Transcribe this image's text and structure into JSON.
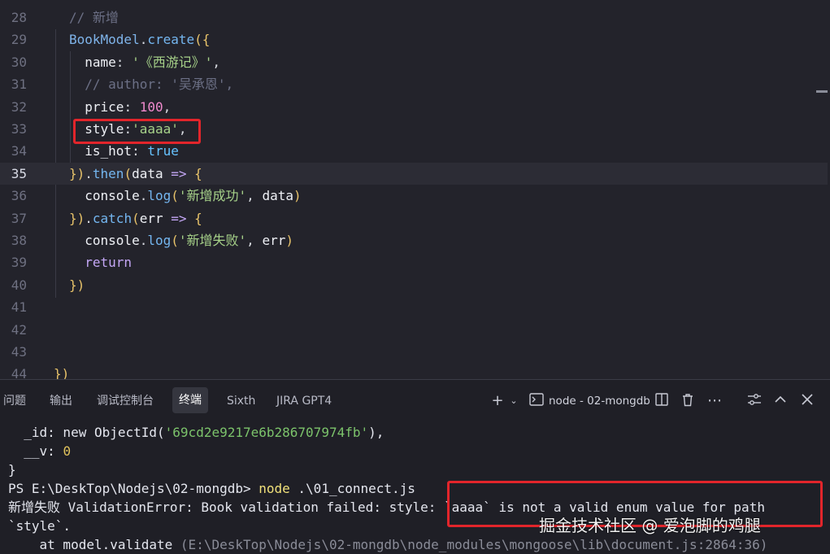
{
  "editor": {
    "lines": [
      {
        "num": "28",
        "segs": [
          {
            "c": "t-com",
            "t": "// 新增"
          }
        ]
      },
      {
        "num": "29",
        "segs": [
          {
            "c": "t-obj",
            "t": "BookModel"
          },
          {
            "c": "t-plain",
            "t": "."
          },
          {
            "c": "t-fn",
            "t": "create"
          },
          {
            "c": "t-pun",
            "t": "({"
          }
        ]
      },
      {
        "num": "30",
        "segs": [
          {
            "c": "t-key",
            "t": "  name"
          },
          {
            "c": "t-plain",
            "t": ": "
          },
          {
            "c": "t-str",
            "t": "'《西游记》'"
          },
          {
            "c": "t-plain",
            "t": ","
          }
        ]
      },
      {
        "num": "31",
        "segs": [
          {
            "c": "t-com",
            "t": "  // author: '吴承恩',"
          }
        ]
      },
      {
        "num": "32",
        "segs": [
          {
            "c": "t-key",
            "t": "  price"
          },
          {
            "c": "t-plain",
            "t": ": "
          },
          {
            "c": "t-num",
            "t": "100"
          },
          {
            "c": "t-plain",
            "t": ","
          }
        ]
      },
      {
        "num": "33",
        "segs": [
          {
            "c": "t-key",
            "t": "  style"
          },
          {
            "c": "t-plain",
            "t": ":"
          },
          {
            "c": "t-str",
            "t": "'aaaa'"
          },
          {
            "c": "t-plain",
            "t": ","
          }
        ]
      },
      {
        "num": "34",
        "segs": [
          {
            "c": "t-key",
            "t": "  is_hot"
          },
          {
            "c": "t-plain",
            "t": ": "
          },
          {
            "c": "t-bool",
            "t": "true"
          }
        ]
      },
      {
        "num": "35",
        "segs": [
          {
            "c": "t-pun",
            "t": "})"
          },
          {
            "c": "t-plain",
            "t": "."
          },
          {
            "c": "t-fn",
            "t": "then"
          },
          {
            "c": "t-pun",
            "t": "("
          },
          {
            "c": "t-key",
            "t": "data"
          },
          {
            "c": "t-arr",
            "t": " => "
          },
          {
            "c": "t-pun",
            "t": "{"
          }
        ]
      },
      {
        "num": "36",
        "segs": [
          {
            "c": "t-key",
            "t": "  console"
          },
          {
            "c": "t-plain",
            "t": "."
          },
          {
            "c": "t-fn",
            "t": "log"
          },
          {
            "c": "t-pun",
            "t": "("
          },
          {
            "c": "t-str",
            "t": "'新增成功'"
          },
          {
            "c": "t-plain",
            "t": ", "
          },
          {
            "c": "t-key",
            "t": "data"
          },
          {
            "c": "t-pun",
            "t": ")"
          }
        ]
      },
      {
        "num": "37",
        "segs": [
          {
            "c": "t-pun",
            "t": "})"
          },
          {
            "c": "t-plain",
            "t": "."
          },
          {
            "c": "t-fn",
            "t": "catch"
          },
          {
            "c": "t-pun",
            "t": "("
          },
          {
            "c": "t-key",
            "t": "err"
          },
          {
            "c": "t-arr",
            "t": " => "
          },
          {
            "c": "t-pun",
            "t": "{"
          }
        ]
      },
      {
        "num": "38",
        "segs": [
          {
            "c": "t-key",
            "t": "  console"
          },
          {
            "c": "t-plain",
            "t": "."
          },
          {
            "c": "t-fn",
            "t": "log"
          },
          {
            "c": "t-pun",
            "t": "("
          },
          {
            "c": "t-str",
            "t": "'新增失败'"
          },
          {
            "c": "t-plain",
            "t": ", "
          },
          {
            "c": "t-key",
            "t": "err"
          },
          {
            "c": "t-pun",
            "t": ")"
          }
        ]
      },
      {
        "num": "39",
        "segs": [
          {
            "c": "t-kw",
            "t": "  return"
          }
        ]
      },
      {
        "num": "40",
        "segs": [
          {
            "c": "t-pun",
            "t": "})"
          }
        ]
      },
      {
        "num": "41",
        "segs": []
      },
      {
        "num": "42",
        "segs": []
      },
      {
        "num": "43",
        "segs": []
      },
      {
        "num": "44",
        "segs": [
          {
            "c": "t-pun",
            "t": "})"
          }
        ]
      }
    ],
    "active_line": "35"
  },
  "panel": {
    "tabs": [
      "问题",
      "输出",
      "调试控制台",
      "终端",
      "Sixth",
      "JIRA GPT4"
    ],
    "active_tab": "终端",
    "terminal_name": "node - 02-mongdb",
    "icons": [
      "plus-icon",
      "chevron-down-icon",
      "terminal-icon",
      "split-icon",
      "trash-icon",
      "more-icon",
      "settings-icon",
      "chevron-up-icon",
      "close-icon"
    ]
  },
  "terminal": {
    "id_key": "  _id: new ObjectId(",
    "id_value": "'69cd2e9217e6b286707974fb'",
    "id_close": "),",
    "v_key": "  __v: ",
    "v_value": "0",
    "brace": "}",
    "prompt": "PS E:\\DeskTop\\Nodejs\\02-mongdb> ",
    "cmd_node": "node",
    "cmd_arg": " .\\01_connect.js",
    "error_line": "新增失败 ValidationError: Book validation failed: style: `aaaa` is not a valid enum value for path",
    "error_line2": "`style`.",
    "at_prefix": "    at model.validate ",
    "at_path": "(E:\\DeskTop\\Nodejs\\02-mongdb\\node_modules\\mongoose\\lib\\document.js:2864:36)"
  },
  "watermark": "掘金技术社区 @ 爱泡脚的鸡腿",
  "colors": {
    "highlight": "#e2252b",
    "string": "#a6d189",
    "number": "#f08acd"
  }
}
